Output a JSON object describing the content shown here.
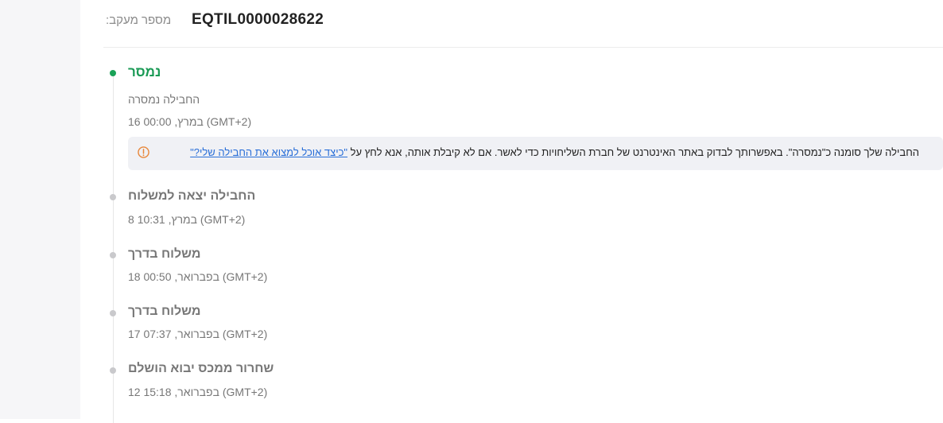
{
  "tracking": {
    "label": "מספר מעקב:",
    "number": "EQTIL0000028622"
  },
  "events": [
    {
      "title": "נמסר",
      "subtitle": "החבילה נמסרה",
      "date": "16 במרץ, 00:00 (GMT+2)",
      "active": true,
      "note": {
        "text": "החבילה שלך סומנה כ\"נמסרה\". באפשרותך לבדוק באתר האינטרנט של חברת השליחויות כדי לאשר. אם לא קיבלת אותה, אנא לחץ על",
        "link": "\"כיצד אוכל למצוא את החבילה שלי?\"",
        "icon": "info-icon"
      }
    },
    {
      "title": "החבילה יצאה למשלוח",
      "date": "8 במרץ, 10:31 (GMT+2)"
    },
    {
      "title": "משלוח בדרך",
      "date": "18 בפברואר, 00:50 (GMT+2)"
    },
    {
      "title": "משלוח בדרך",
      "date": "17 בפברואר, 07:37 (GMT+2)"
    },
    {
      "title": "שחרור ממכס יבוא הושלם",
      "date": "12 בפברואר, 15:18 (GMT+2)"
    }
  ],
  "colors": {
    "active": "#1aa257",
    "inactive_dot": "#c9c9cc",
    "link": "#2a6fd8",
    "warning_icon": "#e8873a"
  }
}
